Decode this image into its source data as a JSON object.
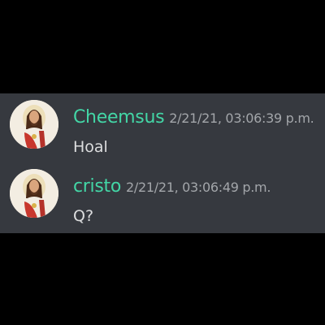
{
  "colors": {
    "page_background": "#000000",
    "chat_background": "#36393f",
    "username": "#43d6a6",
    "timestamp": "#a3a6aa",
    "message_text": "#dcddde"
  },
  "messages": [
    {
      "username": "Cheemsus",
      "timestamp": "2/21/21, 03:06:39 p.m.",
      "content": "Hoal",
      "avatar_icon": "jesus-portrait-avatar"
    },
    {
      "username": "cristo",
      "timestamp": "2/21/21, 03:06:49 p.m.",
      "content": "Q?",
      "avatar_icon": "jesus-portrait-avatar"
    }
  ]
}
